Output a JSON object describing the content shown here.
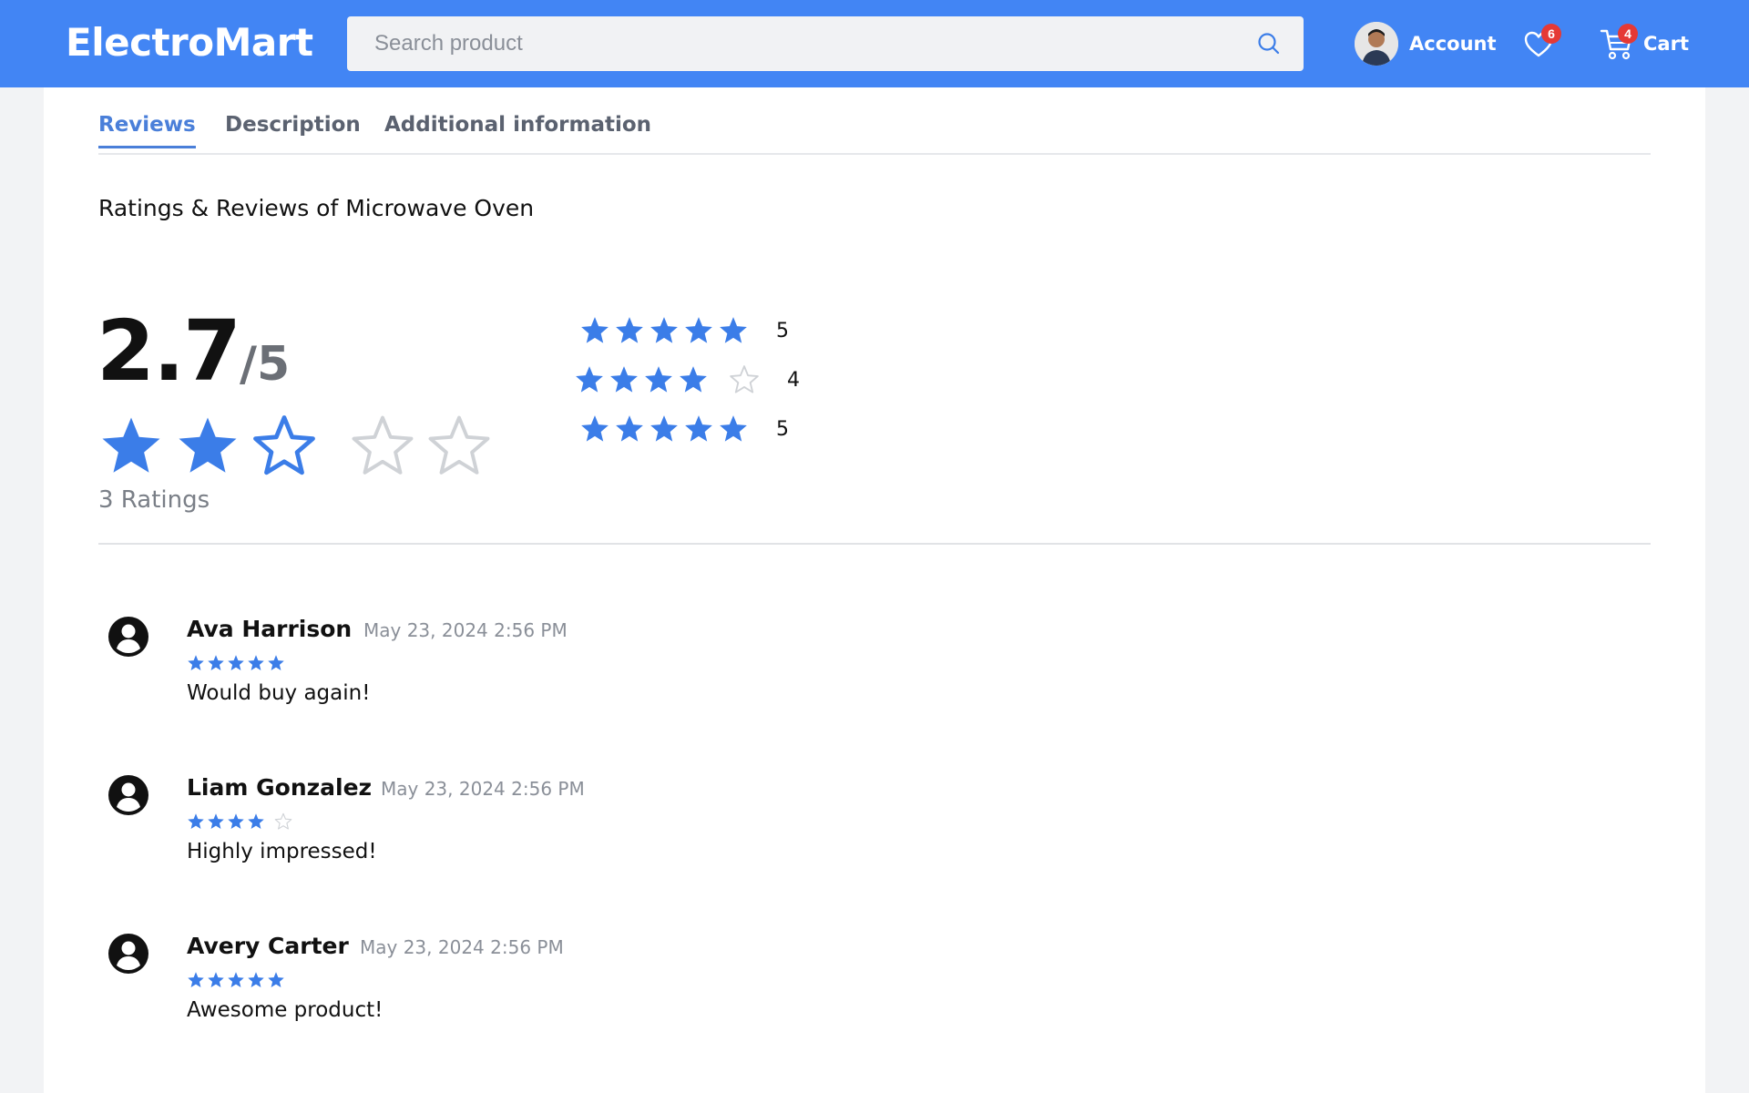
{
  "header": {
    "logo": "ElectroMart",
    "search": {
      "placeholder": "Search product",
      "value": ""
    },
    "account_label": "Account",
    "wishlist_count": "6",
    "cart_label": "Cart",
    "cart_count": "4"
  },
  "tabs": [
    {
      "label": "Reviews",
      "active": true
    },
    {
      "label": "Description",
      "active": false
    },
    {
      "label": "Additional information",
      "active": false
    }
  ],
  "reviews_section": {
    "title": "Ratings & Reviews of Microwave Oven",
    "average": "2.7",
    "out_of": "/5",
    "average_star_fill": [
      1,
      1,
      0.5,
      0,
      0
    ],
    "ratings_count_text": "3 Ratings",
    "distribution": [
      {
        "stars": 5,
        "count": "5"
      },
      {
        "stars": 4,
        "count": "4"
      },
      {
        "stars": 5,
        "count": "5"
      }
    ]
  },
  "reviews": [
    {
      "name": "Ava Harrison",
      "date": "May 23, 2024 2:56 PM",
      "rating": 5,
      "comment": "Would buy again!"
    },
    {
      "name": "Liam Gonzalez",
      "date": "May 23, 2024 2:56 PM",
      "rating": 4,
      "comment": "Highly impressed!"
    },
    {
      "name": "Avery Carter",
      "date": "May 23, 2024 2:56 PM",
      "rating": 5,
      "comment": "Awesome product!"
    }
  ],
  "colors": {
    "header_bg": "#4285f4",
    "star_filled": "#3b7de8",
    "star_empty": "#cfd2d6",
    "badge": "#e53935",
    "tab_active": "#4a7fd9"
  }
}
